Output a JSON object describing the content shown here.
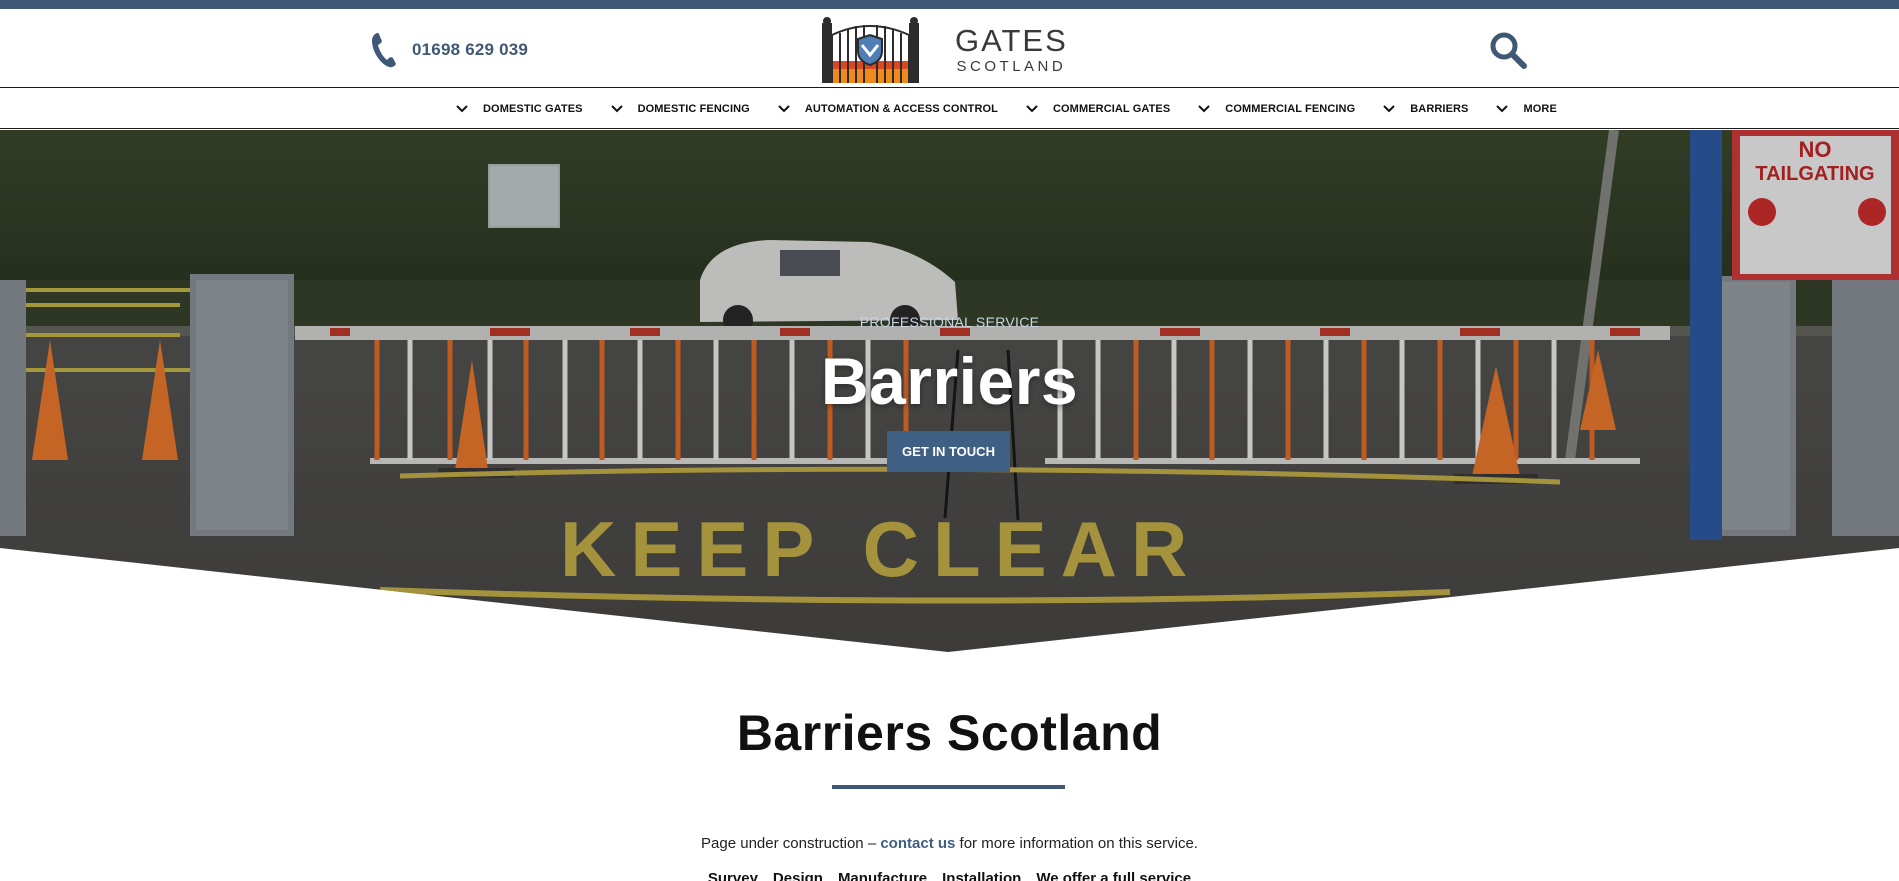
{
  "header": {
    "phone": "01698 629 039",
    "logo_line1": "GATES",
    "logo_line2": "SCOTLAND"
  },
  "nav": {
    "items": [
      {
        "label": "DOMESTIC GATES"
      },
      {
        "label": "DOMESTIC FENCING"
      },
      {
        "label": "AUTOMATION & ACCESS CONTROL"
      },
      {
        "label": "COMMERCIAL GATES"
      },
      {
        "label": "COMMERCIAL FENCING"
      },
      {
        "label": "BARRIERS"
      },
      {
        "label": "MORE"
      }
    ]
  },
  "hero": {
    "eyebrow": "PROFESSIONAL SERVICE",
    "title": "Barriers",
    "cta": "GET IN TOUCH",
    "sign_line1": "NO",
    "sign_line2": "TAILGATING",
    "road_text": "KEEP CLEAR"
  },
  "main": {
    "heading": "Barriers Scotland",
    "para_before": "Page under construction – ",
    "para_link": "contact us",
    "para_after": " for more information on this service.",
    "services": [
      "Survey",
      "Design",
      "Manufacture",
      "Installation",
      "We offer a full service"
    ]
  },
  "colors": {
    "brand": "#3f5875",
    "cta": "#3f5f84"
  }
}
